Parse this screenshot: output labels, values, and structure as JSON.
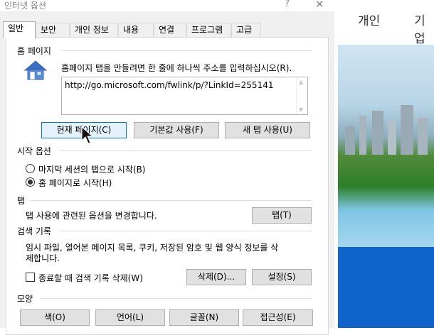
{
  "window": {
    "title": "인터넷 옵션",
    "help": "?",
    "close": "✕"
  },
  "tabs": [
    {
      "label": "일반",
      "active": true
    },
    {
      "label": "보안"
    },
    {
      "label": "개인 정보"
    },
    {
      "label": "내용"
    },
    {
      "label": "연결"
    },
    {
      "label": "프로그램"
    },
    {
      "label": "고급"
    }
  ],
  "home_page": {
    "section_label": "홈 페이지",
    "icon": "home-icon",
    "description": "홈페이지 탭을 만들려면 한 줄에 하나씩 주소를 입력하십시오(R).",
    "url": "http://go.microsoft.com/fwlink/p/?LinkId=255141",
    "buttons": {
      "current": "현재 페이지(C)",
      "default": "기본값 사용(F)",
      "new_tab": "새 탭 사용(U)"
    }
  },
  "startup": {
    "section_label": "시작 옵션",
    "option1": "마지막 세션의 탭으로 시작(B)",
    "option2": "홈 페이지로 시작(H)",
    "selected": "option2"
  },
  "tabs_section": {
    "section_label": "탭",
    "description": "탭 사용에 관련된 옵션을 변경합니다.",
    "button": "탭(T)"
  },
  "history": {
    "section_label": "검색 기록",
    "description_line1": "임시 파일, 열어본 페이지 목록, 쿠키, 저장된 암호 및 웹 양식 정보를 삭",
    "description_line2": "제합니다.",
    "checkbox_label": "종료할 때 검색 기록 삭제(W)",
    "checkbox_checked": false,
    "delete_button": "삭제(D)...",
    "settings_button": "설정(S)"
  },
  "appearance": {
    "section_label": "모양",
    "buttons": {
      "colors": "색(O)",
      "languages": "언어(L)",
      "fonts": "글꼴(N)",
      "accessibility": "접근성(E)"
    }
  },
  "background_page": {
    "nav1": "개인",
    "nav2": "기업"
  },
  "colors": {
    "dialog_bg": "#f0f0f0",
    "focus_blue": "#0078d7",
    "brand_blue": "#1063c9"
  }
}
